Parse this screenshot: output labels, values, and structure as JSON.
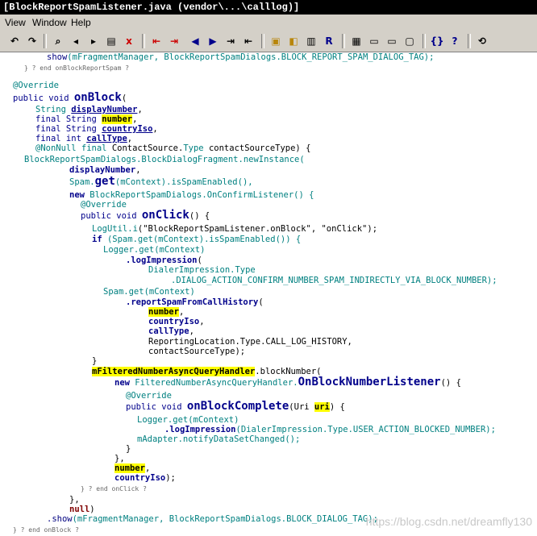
{
  "window": {
    "title": "[BlockReportSpamListener.java (vendor\\...\\calllog)]"
  },
  "menu": {
    "view": "View",
    "window": "Window",
    "help": "Help"
  },
  "toolbar": {
    "icons": [
      "undo-icon",
      "redo-icon",
      "find-icon",
      "find-prev-icon",
      "find-next-icon",
      "find-files-icon",
      "replace-icon",
      "jump-back-icon",
      "jump-forward-icon",
      "back-icon",
      "forward-icon",
      "indent-icon",
      "outdent-icon",
      "lock-icon",
      "bookmark-icon",
      "book-icon",
      "relation-icon",
      "layout1-icon",
      "layout2-icon",
      "layout3-icon",
      "layout4-icon",
      "symbol-info-icon",
      "help-icon",
      "sync-icon"
    ]
  },
  "code": {
    "l01a": "show",
    "l01b": "(mFragmentManager, BlockReportSpamDialogs.BLOCK_REPORT_SPAM_DIALOG_TAG);",
    "l02": "} ? end onBlockReportSpam ?",
    "l03": "@Override",
    "l04a": "public void ",
    "l04b": "onBlock",
    "l04c": "(",
    "l05a": "String ",
    "l05b": "displayNumber",
    "l05c": ",",
    "l06a": "final String ",
    "l06b": "number",
    "l06c": ",",
    "l07a": "final String ",
    "l07b": "countryIso",
    "l07c": ",",
    "l08a": "final int ",
    "l08b": "callType",
    "l08c": ",",
    "l09a": "@NonNull final ",
    "l09b": "ContactSource.",
    "l09c": "Type",
    "l09d": " contactSourceType) {",
    "l10": "BlockReportSpamDialogs.BlockDialogFragment.newInstance(",
    "l11a": "displayNumber",
    "l11b": ",",
    "l12a": "Spam.",
    "l12b": "get",
    "l12c": "(mContext).isSpamEnabled(),",
    "l13a": "new ",
    "l13b": "BlockReportSpamDialogs.OnConfirmListener() {",
    "l14": "@Override",
    "l15a": "public void ",
    "l15b": "onClick",
    "l15c": "() {",
    "l16a": "LogUtil.",
    "l16b": "i",
    "l16c": "(\"BlockReportSpamListener.onBlock\", \"onClick\");",
    "l17a": "if ",
    "l17b": "(Spam.get(mContext).isSpamEnabled()) {",
    "l18": "Logger.get(mContext)",
    "l19a": ".logImpression",
    "l19b": "(",
    "l20": "DialerImpression.Type",
    "l21": ".DIALOG_ACTION_CONFIRM_NUMBER_SPAM_INDIRECTLY_VIA_BLOCK_NUMBER);",
    "l22": "Spam.get(mContext)",
    "l23a": ".reportSpamFromCallHistory",
    "l23b": "(",
    "l24a": "number",
    "l24b": ",",
    "l25a": "countryIso",
    "l25b": ",",
    "l26a": "callType",
    "l26b": ",",
    "l27": "ReportingLocation.Type.CALL_LOG_HISTORY,",
    "l28": "contactSourceType);",
    "l29": "}",
    "l30a": "mFilteredNumberAsyncQueryHandler",
    "l30b": ".blockNumber(",
    "l31a": "new ",
    "l31b": "FilteredNumberAsyncQueryHandler.",
    "l31c": "OnBlockNumberListener",
    "l31d": "() {",
    "l32": "@Override",
    "l33a": "public void ",
    "l33b": "onBlockComplete",
    "l33c": "(Uri ",
    "l33d": "uri",
    "l33e": ") {",
    "l34": "Logger.get(mContext)",
    "l35a": ".logImpression",
    "l35b": "(DialerImpression.Type.USER_ACTION_BLOCKED_NUMBER);",
    "l36": "mAdapter.notifyDataSetChanged();",
    "l37": "}",
    "l38": "},",
    "l39a": "number",
    "l39b": ",",
    "l40a": "countryIso",
    "l40b": ");",
    "l41": "} ? end onClick ?",
    "l42": "},",
    "l43a": "null",
    "l43b": ")",
    "l44a": ".show",
    "l44b": "(mFragmentManager, BlockReportSpamDialogs.BLOCK_DIALOG_TAG);",
    "l45": "} ? end onBlock ?"
  },
  "watermark": "https://blog.csdn.net/dreamfly130"
}
